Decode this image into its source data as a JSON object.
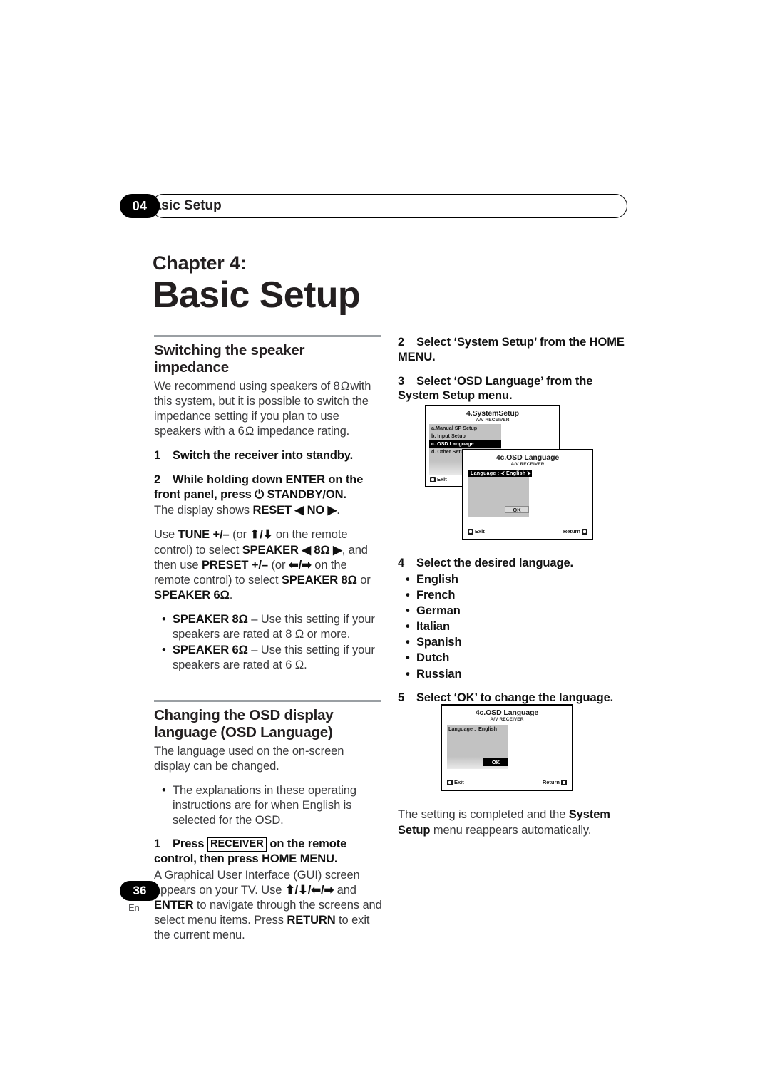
{
  "header": {
    "chapter_number": "04",
    "chapter_label": "Basic Setup"
  },
  "chapter": {
    "eyebrow": "Chapter 4:",
    "title": "Basic Setup"
  },
  "left_column": {
    "section1": {
      "heading": "Switching the speaker impedance",
      "intro": "We recommend using speakers of 8 Ω with this system, but it is possible to switch the impedance setting if you plan to use speakers with a 6 Ω impedance rating.",
      "step1_num": "1",
      "step1_text": "Switch the receiver into standby.",
      "step2_num": "2",
      "step2_text": "While holding down ENTER on the front panel, press ⏻ STANDBY/ON.",
      "step2_body": "The display shows RESET ◄ NO ►.",
      "para_use": "Use TUNE +/– (or ⬆/⬇ on the remote control) to select SPEAKER ◄ 8Ω ►, and then use PRESET +/– (or ⬅/➡ on the remote control) to select SPEAKER 8Ω or SPEAKER 6Ω.",
      "bullets": [
        {
          "term": "SPEAKER 8Ω",
          "rest": " – Use this setting if your speakers are rated at 8 Ω or more."
        },
        {
          "term": "SPEAKER 6Ω",
          "rest": " – Use this setting if your speakers are rated at 6 Ω."
        }
      ]
    },
    "section2": {
      "heading_line1": "Changing the OSD display",
      "heading_line2": "language (OSD Language)",
      "intro": "The language used on the on-screen display can be changed.",
      "bullet1": "The explanations in these operating instructions are for when English is selected for the OSD.",
      "step1_num": "1",
      "step1_pre": "Press",
      "step1_key": "RECEIVER",
      "step1_post": "on the remote control, then press HOME MENU.",
      "step1_body": "A Graphical User Interface (GUI) screen appears on your TV. Use ⬆/⬇/⬅/➡ and ENTER to navigate through the screens and select menu items. Press RETURN to exit the current menu."
    }
  },
  "right_column": {
    "step2_num": "2",
    "step2_text": "Select ‘System Setup’ from the HOME MENU.",
    "step3_num": "3",
    "step3_text": "Select ‘OSD Language’ from the System Setup menu.",
    "step4_num": "4",
    "step4_text": "Select the desired language.",
    "languages": [
      "English",
      "French",
      "German",
      "Italian",
      "Spanish",
      "Dutch",
      "Russian"
    ],
    "step5_num": "5",
    "step5_text": "Select ‘OK’ to change the language.",
    "closing": "The setting is completed and the System Setup menu reappears automatically.",
    "closing_bold": "System Setup"
  },
  "osd_screens": {
    "system_setup": {
      "title": "4.SystemSetup",
      "subtitle": "A/V RECEIVER",
      "menu_items": [
        "a.Manual SP Setup",
        "b. Input Setup",
        "c. OSD Language",
        "d. Other Setup"
      ],
      "selected_index": 2,
      "exit_label": "Exit"
    },
    "osd_language_1": {
      "title": "4c.OSD Language",
      "subtitle": "A/V RECEIVER",
      "language_row": "Language : ⮜  English  ⮞",
      "ok_label": "OK",
      "exit_label": "Exit",
      "return_label": "Return"
    },
    "osd_language_2": {
      "title": "4c.OSD Language",
      "subtitle": "A/V RECEIVER",
      "language_label": "Language :",
      "language_value": "English",
      "ok_label": "OK",
      "exit_label": "Exit",
      "return_label": "Return"
    }
  },
  "footer": {
    "page_number": "36",
    "language_code": "En"
  }
}
